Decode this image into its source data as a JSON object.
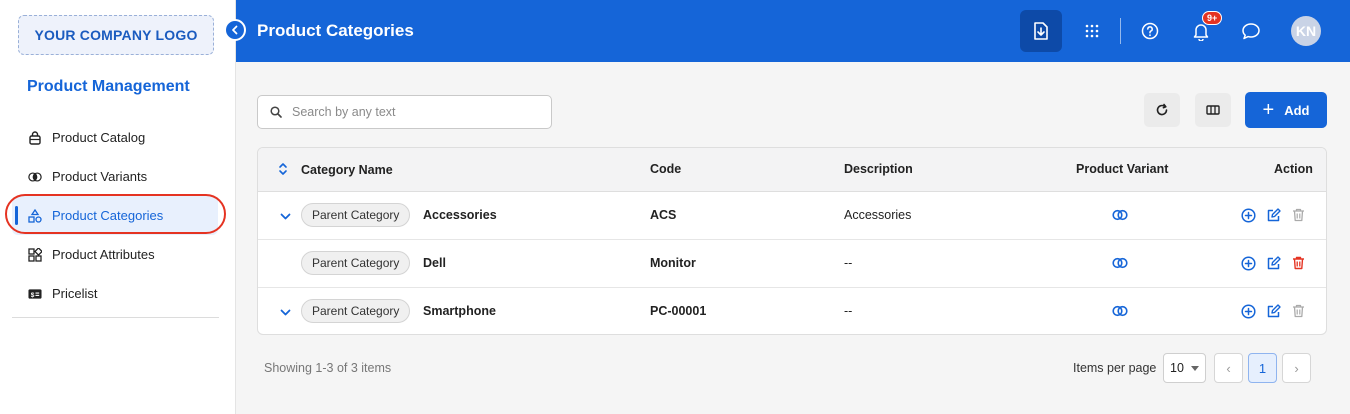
{
  "sidebar": {
    "logo": "YOUR COMPANY LOGO",
    "section_title": "Product Management",
    "items": [
      {
        "label": "Product Catalog",
        "icon": "lock-box-icon",
        "active": false
      },
      {
        "label": "Product Variants",
        "icon": "overlap-circles-icon",
        "active": false
      },
      {
        "label": "Product Categories",
        "icon": "shapes-icon",
        "active": true
      },
      {
        "label": "Product Attributes",
        "icon": "grid-icon",
        "active": false
      },
      {
        "label": "Pricelist",
        "icon": "price-tag-icon",
        "active": false
      }
    ]
  },
  "header": {
    "title": "Product Categories",
    "notification_badge": "9+",
    "avatar_initials": "KN",
    "icons": [
      "download-icon",
      "apps-grid-icon",
      "help-icon",
      "bell-icon",
      "chat-icon"
    ]
  },
  "toolbar": {
    "search_placeholder": "Search by any text",
    "add_label": "Add",
    "refresh_icon": "refresh-icon",
    "columns_icon": "columns-icon"
  },
  "table": {
    "columns": [
      "Category Name",
      "Code",
      "Description",
      "Product Variant",
      "Action"
    ],
    "rows": [
      {
        "expandable": true,
        "chip": "Parent Category",
        "name": "Accessories",
        "code": "ACS",
        "description": "Accessories",
        "delete_active": false
      },
      {
        "expandable": false,
        "chip": "Parent Category",
        "name": "Dell",
        "code": "Monitor",
        "description": "--",
        "delete_active": true
      },
      {
        "expandable": true,
        "chip": "Parent Category",
        "name": "Smartphone",
        "code": "PC-00001",
        "description": "--",
        "delete_active": false
      }
    ]
  },
  "footer": {
    "showing": "Showing 1-3 of 3 items",
    "items_per_page_label": "Items per page",
    "items_per_page": "10",
    "current_page": "1",
    "prev": "‹",
    "next": "›"
  },
  "colors": {
    "primary": "#1565d8",
    "danger": "#e53322",
    "badge": "#e53322"
  }
}
